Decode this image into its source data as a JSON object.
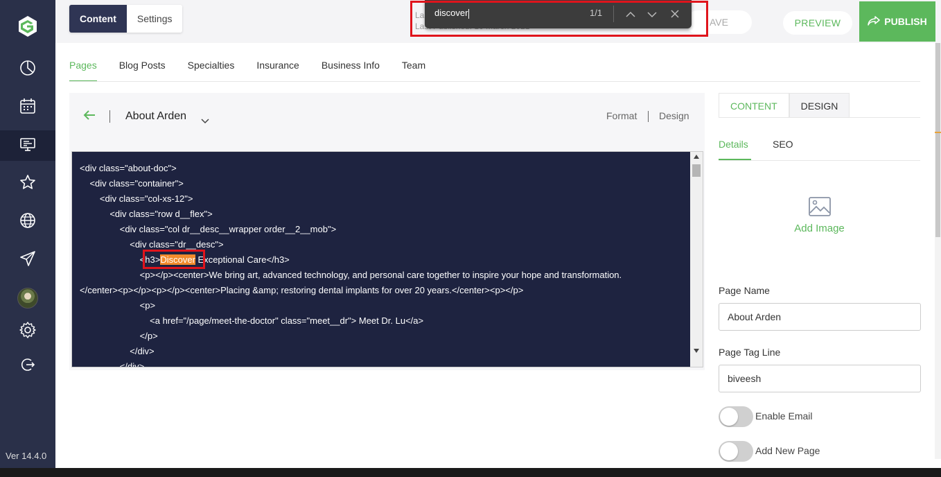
{
  "sidebar": {
    "logo": "g-logo-icon",
    "items": [
      {
        "icon": "dashboard-icon"
      },
      {
        "icon": "calendar-icon"
      },
      {
        "icon": "monitor-icon",
        "active": true
      },
      {
        "icon": "star-icon"
      },
      {
        "icon": "globe-icon"
      },
      {
        "icon": "send-icon"
      },
      {
        "icon": "avatar"
      },
      {
        "icon": "gear-icon"
      },
      {
        "icon": "logout-icon"
      }
    ],
    "version": "Ver 14.4.0"
  },
  "header": {
    "tabs": [
      {
        "label": "Content",
        "active": true
      },
      {
        "label": "Settings",
        "active": false
      }
    ],
    "meta_line1": "Las",
    "meta_line2": "Last Published:  10 March 2021",
    "save_label": "AVE",
    "preview_label": "PREVIEW",
    "publish_label": "PUBLISH"
  },
  "findbar": {
    "query": "discover",
    "count": "1/1"
  },
  "subnav": {
    "items": [
      "Pages",
      "Blog Posts",
      "Specialties",
      "Insurance",
      "Business Info",
      "Team"
    ],
    "active": "Pages"
  },
  "editor": {
    "title": "About Arden",
    "format_label": "Format",
    "design_label": "Design",
    "code": {
      "l1": "<div class=\"about-doc\">",
      "l2": "    <div class=\"container\">",
      "l3": "        <div class=\"col-xs-12\">",
      "l4": "            <div class=\"row d__flex\">",
      "l5": "                <div class=\"col dr__desc__wrapper order__2__mob\">",
      "l6": "                    <div class=\"dr__desc\">",
      "l7_pre": "                        <h3>",
      "l7_match": "Discover",
      "l7_post": " Exceptional Care</h3>",
      "l8": "                        <p></p><center>We bring art, advanced technology, and personal care together to inspire your hope and transformation.",
      "l9": "</center><p></p><p></p><center>Placing &amp; restoring dental implants for over 20 years.</center><p></p>",
      "l10": "                        <p>",
      "l11": "                            <a href=\"/page/meet-the-doctor\" class=\"meet__dr\"> Meet Dr. Lu</a>",
      "l12": "                        </p>",
      "l13": "                    </div>",
      "l14": "                </div>"
    }
  },
  "right_panel": {
    "tabs": [
      {
        "label": "CONTENT",
        "active": true
      },
      {
        "label": "DESIGN",
        "active": false
      }
    ],
    "subtabs": [
      {
        "label": "Details",
        "active": true
      },
      {
        "label": "SEO",
        "active": false
      }
    ],
    "add_image_label": "Add Image",
    "page_name_label": "Page Name",
    "page_name_value": "About Arden",
    "page_tagline_label": "Page Tag Line",
    "page_tagline_value": "biveesh",
    "toggle_email_label": "Enable Email",
    "toggle_email_on": false,
    "toggle_newpage_label": "Add New Page",
    "toggle_newpage_on": false
  },
  "colors": {
    "accent": "#5cb85c",
    "sidebar": "#2a3049",
    "code_bg": "#1e2340",
    "highlight": "#f28b2c",
    "annotation": "#e0141c"
  }
}
